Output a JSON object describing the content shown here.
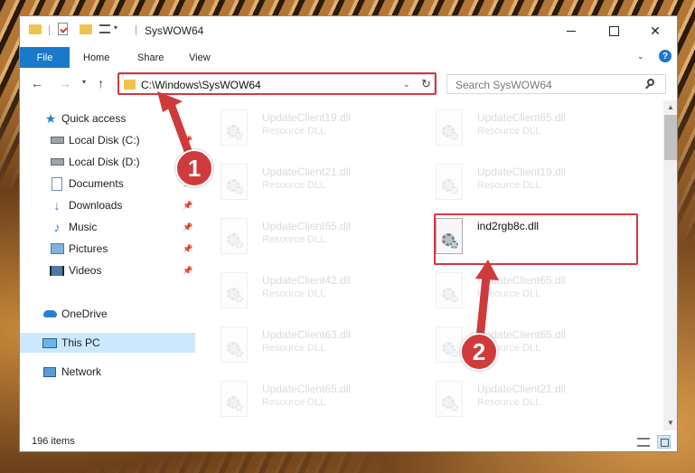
{
  "window": {
    "title": "SysWOW64",
    "icons": [
      "folder-icon",
      "properties-icon",
      "new-folder-icon",
      "view-icon",
      "customize-arrow-icon"
    ],
    "controls": {
      "minimize": "minimize-icon",
      "maximize": "maximize-icon",
      "close": "✕"
    }
  },
  "ribbon": {
    "tabs": [
      "File",
      "Home",
      "Share",
      "View"
    ],
    "help": "?"
  },
  "navbar": {
    "address": "C:\\Windows\\SysWOW64",
    "search_placeholder": "Search SysWOW64"
  },
  "sidebar": {
    "items": [
      {
        "label": "Quick access",
        "icon": "star-icon"
      },
      {
        "label": "Local Disk (C:)",
        "icon": "drive-icon"
      },
      {
        "label": "Local Disk (D:)",
        "icon": "drive-icon"
      },
      {
        "label": "Documents",
        "icon": "documents-icon"
      },
      {
        "label": "Downloads",
        "icon": "download-icon"
      },
      {
        "label": "Music",
        "icon": "music-icon"
      },
      {
        "label": "Pictures",
        "icon": "pictures-icon"
      },
      {
        "label": "Videos",
        "icon": "videos-icon"
      },
      {
        "label": "OneDrive",
        "icon": "cloud-icon"
      },
      {
        "label": "This PC",
        "icon": "computer-icon",
        "selected": true
      },
      {
        "label": "Network",
        "icon": "network-icon"
      }
    ]
  },
  "files": [
    {
      "name": "UpdateClient19.dll",
      "type": "Resource DLL"
    },
    {
      "name": "UpdateClient65.dll",
      "type": "Resource DLL"
    },
    {
      "name": "UpdateClient21.dll",
      "type": "Resource DLL"
    },
    {
      "name": "UpdateClient19.dll",
      "type": "Resource DLL"
    },
    {
      "name": "UpdateClient65.dll",
      "type": "Resource DLL"
    },
    {
      "name": "ind2rgb8c.dll",
      "type": "",
      "highlighted": true
    },
    {
      "name": "UpdateClient42.dll",
      "type": "Resource DLL"
    },
    {
      "name": "UpdateClient65.dll",
      "type": "Resource DLL"
    },
    {
      "name": "UpdateClient63.dll",
      "type": "Resource DLL"
    },
    {
      "name": "UpdateClient65.dll",
      "type": "Resource DLL"
    },
    {
      "name": "UpdateClient65.dll",
      "type": "Resource DLL"
    },
    {
      "name": "UpdateClient21.dll",
      "type": "Resource DLL"
    }
  ],
  "status": {
    "item_count": "196 items"
  },
  "annotations": {
    "step1": "1",
    "step2": "2",
    "color": "#d9363e"
  }
}
